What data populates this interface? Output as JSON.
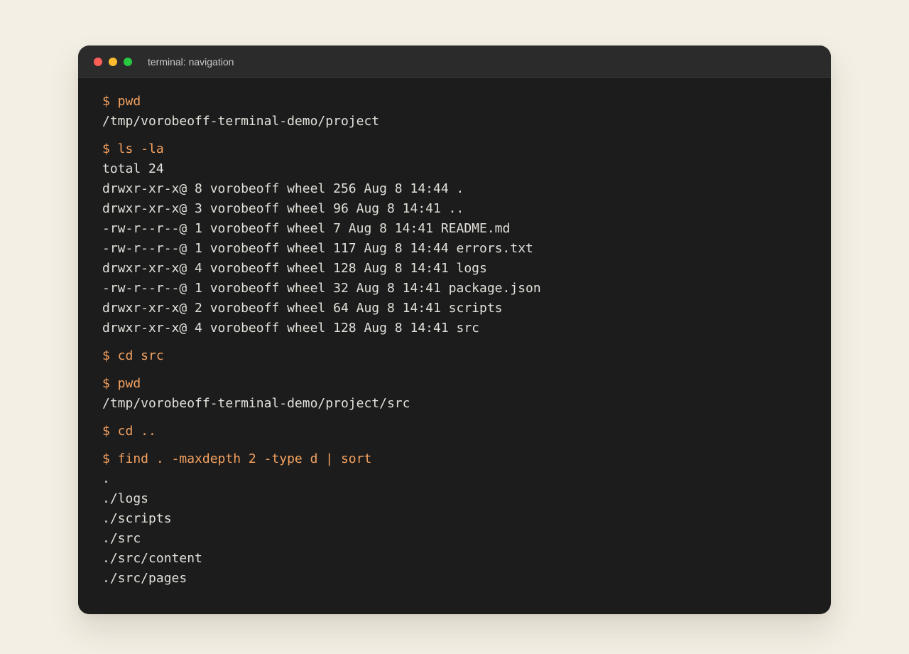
{
  "window": {
    "title": "terminal: navigation"
  },
  "colors": {
    "background": "#f3efe4",
    "terminal_bg": "#1c1c1c",
    "titlebar_bg": "#2b2b2b",
    "command": "#f4a261",
    "output": "#e2e0da",
    "close": "#ff5f57",
    "minimize": "#febc2e",
    "maximize": "#28c840"
  },
  "session": [
    {
      "command": "$ pwd",
      "output": [
        "/tmp/vorobeoff-terminal-demo/project"
      ]
    },
    {
      "command": "$ ls -la",
      "output": [
        "total 24",
        "drwxr-xr-x@ 8 vorobeoff wheel 256 Aug 8 14:44 .",
        "drwxr-xr-x@ 3 vorobeoff wheel 96 Aug 8 14:41 ..",
        "-rw-r--r--@ 1 vorobeoff wheel 7 Aug 8 14:41 README.md",
        "-rw-r--r--@ 1 vorobeoff wheel 117 Aug 8 14:44 errors.txt",
        "drwxr-xr-x@ 4 vorobeoff wheel 128 Aug 8 14:41 logs",
        "-rw-r--r--@ 1 vorobeoff wheel 32 Aug 8 14:41 package.json",
        "drwxr-xr-x@ 2 vorobeoff wheel 64 Aug 8 14:41 scripts",
        "drwxr-xr-x@ 4 vorobeoff wheel 128 Aug 8 14:41 src"
      ]
    },
    {
      "command": "$ cd src",
      "output": []
    },
    {
      "command": "$ pwd",
      "output": [
        "/tmp/vorobeoff-terminal-demo/project/src"
      ]
    },
    {
      "command": "$ cd ..",
      "output": []
    },
    {
      "command": "$ find . -maxdepth 2 -type d | sort",
      "output": [
        ".",
        "./logs",
        "./scripts",
        "./src",
        "./src/content",
        "./src/pages"
      ]
    }
  ]
}
